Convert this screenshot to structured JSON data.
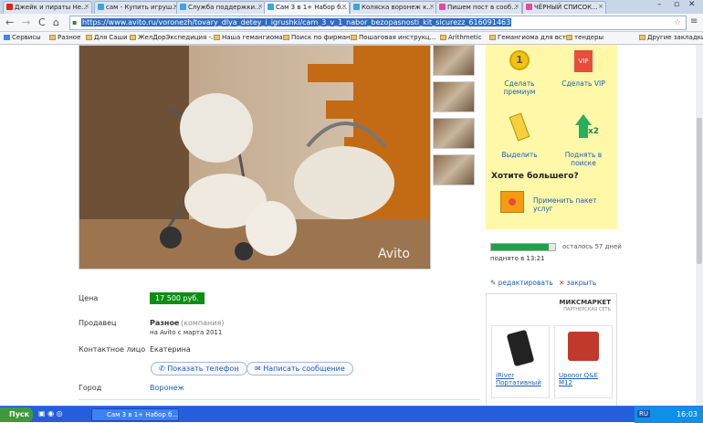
{
  "tabs": [
    {
      "title": "Джейк и пираты Не...",
      "color": "#e62117"
    },
    {
      "title": "сам - Купить игруш...",
      "color": "#3fa3e0"
    },
    {
      "title": "Служба поддержки...",
      "color": "#3fa3e0"
    },
    {
      "title": "Сам 3 в 1+ Набор б...",
      "color": "#3fa3e0"
    },
    {
      "title": "Коляска воронеж к...",
      "color": "#3fa3e0"
    },
    {
      "title": "Пишем пост в сооб...",
      "color": "#e14c9a"
    },
    {
      "title": "ЧЁРНЫЙ СПИСОК...",
      "color": "#e14c9a"
    }
  ],
  "url": "https://www.avito.ru/voronezh/tovary_dlya_detey_i_igrushki/cam_3_v_1_nabor_bezopasnosti_kit_sicurezz_616091463",
  "bookmarks": [
    "Сервисы",
    "Разное",
    "Для Саши",
    "ЖелДорЭкспедиция -...",
    "Наша гемангиома",
    "Поиск по фирман",
    "Пошаговая инструкц...",
    "Arithmetic",
    "Гемангиома для вст...",
    "тендеры",
    "Другие закладки"
  ],
  "watermark": "Avito",
  "listing": {
    "price_label": "Цена",
    "price": "17 500 руб.",
    "seller_label": "Продавец",
    "seller": "Разное",
    "seller_type": "(компания)",
    "seller_since": "на Avito с марта 2011",
    "contact_label": "Контактное лицо",
    "contact": "Екатерина",
    "show_phone": "Показать телефон",
    "write_msg": "Написать сообщение",
    "city_label": "Город",
    "city": "Воронеж"
  },
  "promo": {
    "premium": "Сделать премиум",
    "vip": "Сделать VIP",
    "highlight": "Выделить",
    "raise": "Поднять в поиске",
    "want_more": "Хотите большего?",
    "package": "Применить пакет услуг",
    "vip_badge": "VIP",
    "premium_num": "1",
    "raise_badge": "x2"
  },
  "status": {
    "remaining": "осталось 57 дней",
    "raised": "поднято в 13:21",
    "progress": 0.9,
    "edit": "редактировать",
    "close": "закрыть"
  },
  "mixmarket": {
    "title": "МИКСМАРКЕТ",
    "subtitle": "ПАРТНЕРСКАЯ СЕТЬ",
    "items": [
      {
        "name": "iRiver Портативный"
      },
      {
        "name": "Uponor Q&E M12"
      }
    ]
  },
  "taskbar": {
    "start": "Пуск",
    "task": "Сам 3 в 1+ Набор б...",
    "lang": "RU",
    "time": "16:03"
  }
}
